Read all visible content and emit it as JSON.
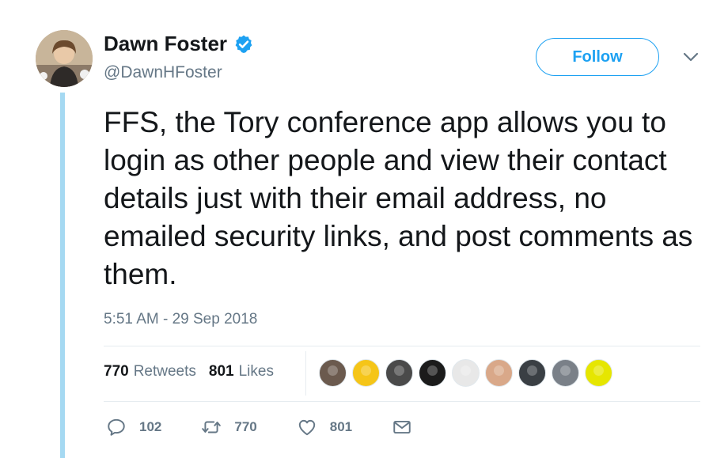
{
  "author": {
    "name": "Dawn Foster",
    "handle": "@DawnHFoster",
    "verified_icon": "verified-badge-icon",
    "avatar_icon": "author-avatar"
  },
  "follow_button": {
    "label": "Follow"
  },
  "menu_icon": "chevron-down-icon",
  "tweet": {
    "text": "FFS, the Tory conference app allows you to login as other people and view their contact details just with their email address, no emailed security links, and post comments as them.",
    "timestamp": "5:51 AM - 29 Sep 2018"
  },
  "stats": {
    "retweets_count": "770",
    "retweets_label": "Retweets",
    "likes_count": "801",
    "likes_label": "Likes"
  },
  "liker_avatars": [
    {
      "name": "liker-avatar-1",
      "color": "#6b5a4e"
    },
    {
      "name": "liker-avatar-2",
      "color": "#f5c518"
    },
    {
      "name": "liker-avatar-3",
      "color": "#4a4a4a"
    },
    {
      "name": "liker-avatar-4",
      "color": "#1b1b1b"
    },
    {
      "name": "liker-avatar-5",
      "color": "#e8e8e8"
    },
    {
      "name": "liker-avatar-6",
      "color": "#d9a889"
    },
    {
      "name": "liker-avatar-7",
      "color": "#3a3f44"
    },
    {
      "name": "liker-avatar-8",
      "color": "#7a8088"
    },
    {
      "name": "liker-avatar-9",
      "color": "#e6e600"
    }
  ],
  "actions": {
    "reply_count": "102",
    "retweet_count": "770",
    "like_count": "801"
  },
  "colors": {
    "accent": "#1da1f2",
    "thread_line": "#a5d9f2",
    "muted_text": "#657786"
  }
}
